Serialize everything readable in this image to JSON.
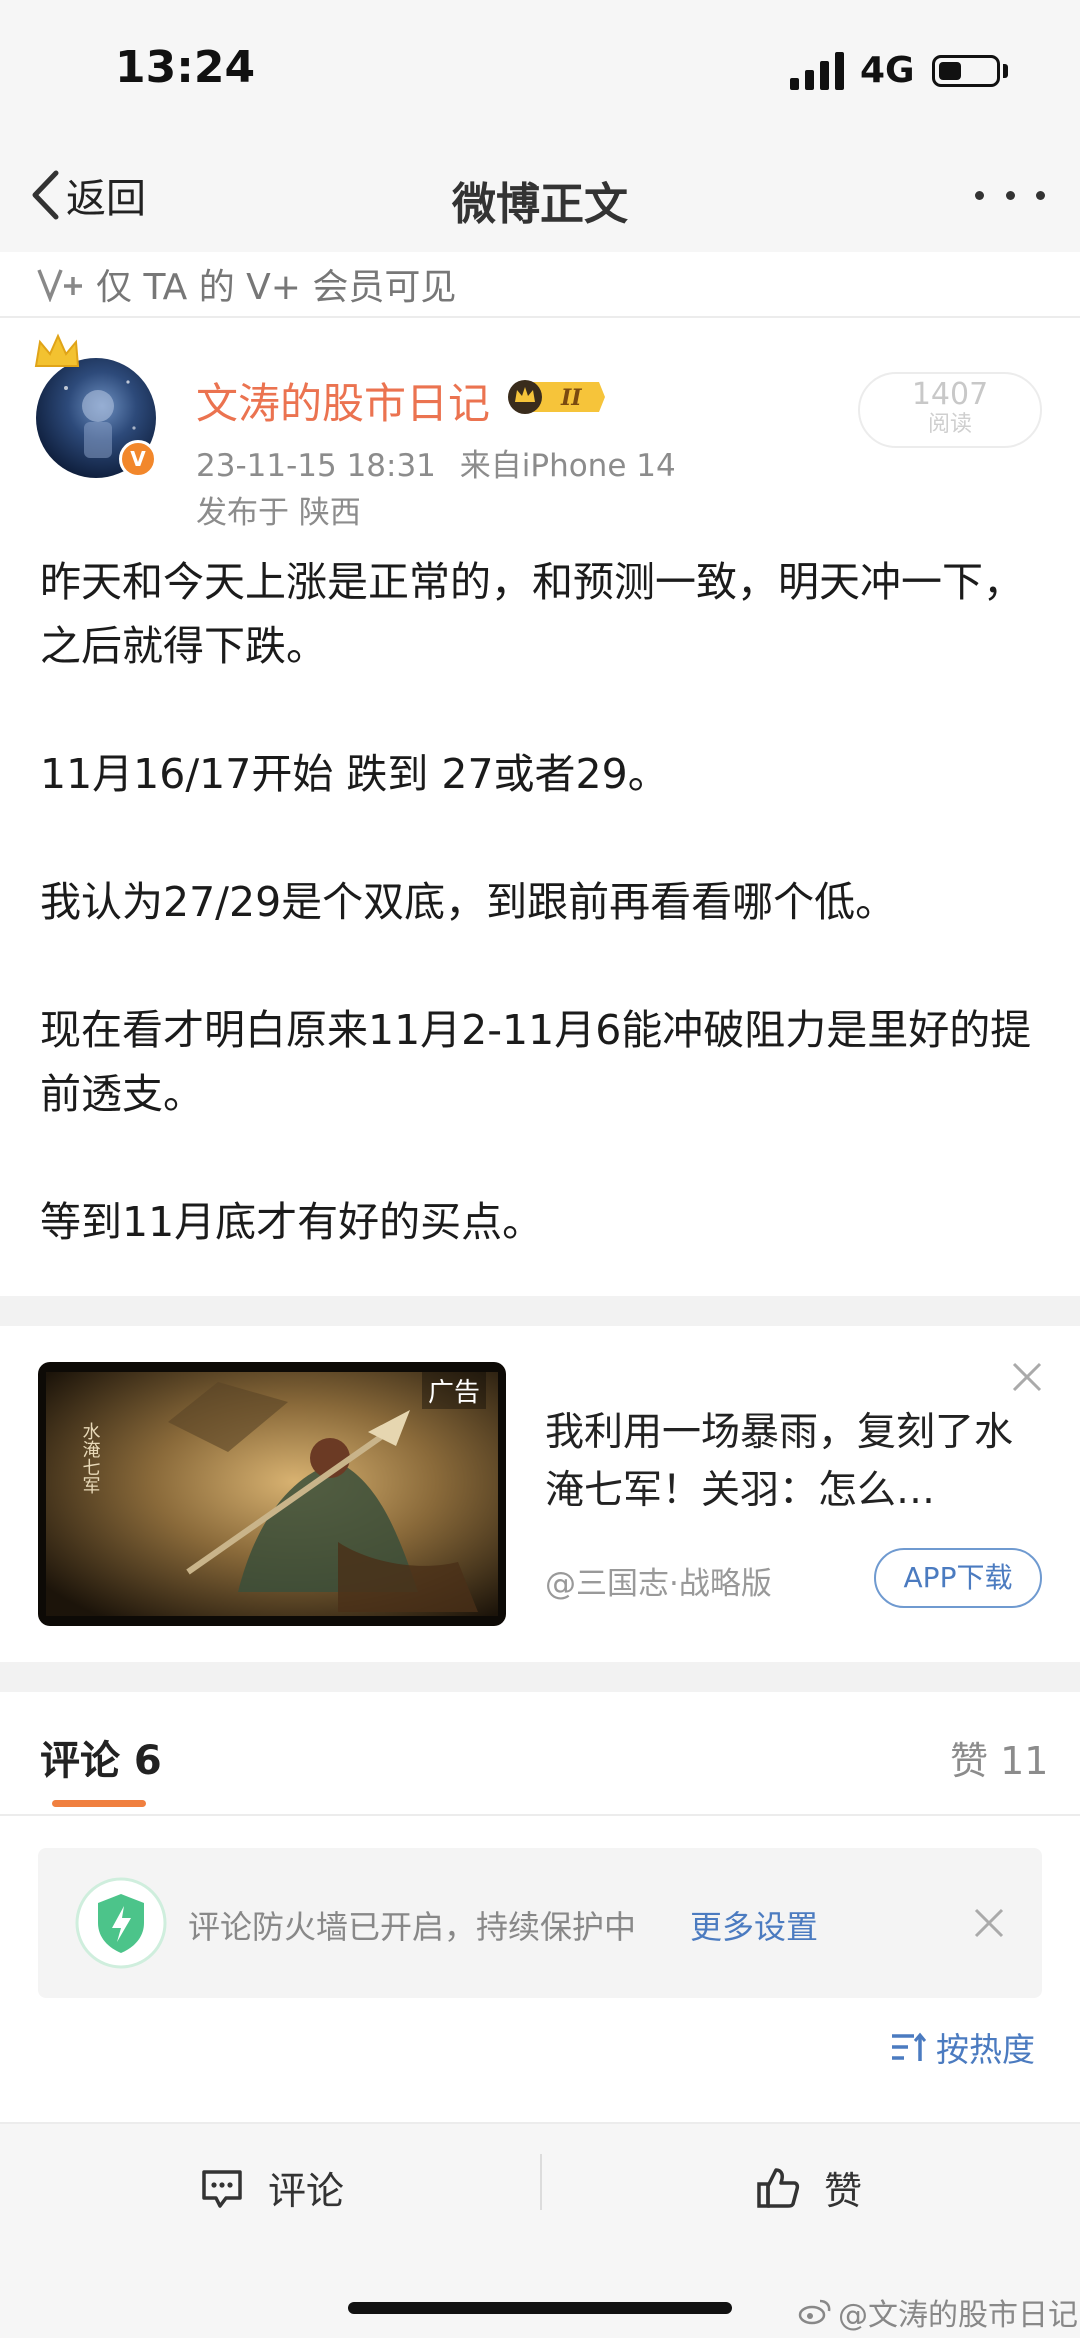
{
  "status_bar": {
    "time": "13:24",
    "network": "4G"
  },
  "nav": {
    "back_label": "返回",
    "title": "微博正文"
  },
  "vip_notice": {
    "text": "仅 TA 的 V+ 会员可见"
  },
  "author": {
    "name": "文涛的股市日记",
    "level_badge": "II",
    "verified_badge": "V",
    "datetime": "23-11-15 18:31",
    "source": "来自iPhone 14",
    "location": "发布于 陕西",
    "read_count": "1407",
    "read_label": "阅读"
  },
  "post": {
    "paragraphs": [
      "昨天和今天上涨是正常的，和预测一致，明天冲一下，之后就得下跌。",
      "11月16/17开始 跌到 27或者29。",
      "我认为27/29是个双底，到跟前再看看哪个低。",
      "现在看才明白原来11月2-11月6能冲破阻力是里好的提前透支。",
      "等到11月底才有好的买点。"
    ]
  },
  "ad": {
    "label": "广告",
    "title": "我利用一场暴雨，复刻了水淹七军！关羽：怎么…",
    "source": "@三国志·战略版",
    "download_label": "APP下载",
    "image_caption": "水淹七军"
  },
  "tabs": {
    "comments_label": "评论 6",
    "likes_label": "赞 11"
  },
  "firewall": {
    "text": "评论防火墙已开启，持续保护中",
    "link": "更多设置"
  },
  "sort": {
    "label": "按热度"
  },
  "bottom_bar": {
    "comment_label": "评论",
    "like_label": "赞"
  },
  "watermark": {
    "text": "@文涛的股市日记"
  },
  "colors": {
    "accent_orange": "#eb7350",
    "link_blue": "#4b7bc0",
    "tab_underline": "#f08040",
    "shield_green": "#4cc48a"
  }
}
